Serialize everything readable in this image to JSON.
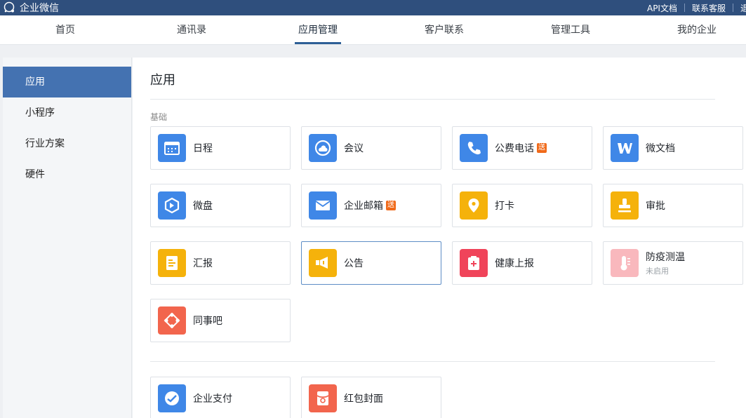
{
  "app": {
    "title": "企业微信"
  },
  "toplinks": [
    "API文档",
    "联系客服",
    "退"
  ],
  "nav": [
    "首页",
    "通讯录",
    "应用管理",
    "客户联系",
    "管理工具",
    "我的企业"
  ],
  "nav_active": "应用管理",
  "sidebar": [
    "应用",
    "小程序",
    "行业方案",
    "硬件"
  ],
  "sidebar_active": "应用",
  "main": {
    "title": "应用",
    "section_label": "基础"
  },
  "apps": [
    {
      "name": "日程",
      "icon": "calendar-icon",
      "color": "#3f87e7"
    },
    {
      "name": "会议",
      "icon": "meeting-icon",
      "color": "#3f87e7"
    },
    {
      "name": "公费电话",
      "badge": "送",
      "icon": "phone-icon",
      "color": "#3f87e7"
    },
    {
      "name": "微文档",
      "icon": "doc-icon",
      "color": "#3f87e7"
    },
    {
      "name": "微盘",
      "icon": "drive-icon",
      "color": "#3f87e7"
    },
    {
      "name": "企业邮箱",
      "badge": "送",
      "icon": "mail-icon",
      "color": "#3f87e7"
    },
    {
      "name": "打卡",
      "icon": "location-icon",
      "color": "#f5b20b"
    },
    {
      "name": "审批",
      "icon": "stamp-icon",
      "color": "#f5b20b"
    },
    {
      "name": "汇报",
      "icon": "report-icon",
      "color": "#f5b20b"
    },
    {
      "name": "公告",
      "icon": "megaphone-icon",
      "color": "#f5b20b"
    },
    {
      "name": "健康上报",
      "icon": "health-icon",
      "color": "#f0445a"
    },
    {
      "name": "防疫测温",
      "sub": "未启用",
      "icon": "thermometer-icon",
      "color": "#f9b8bd"
    },
    {
      "name": "同事吧",
      "icon": "community-icon",
      "color": "#f2654d"
    },
    {
      "name": "企业支付",
      "icon": "pay-icon",
      "color": "#3f87e7"
    },
    {
      "name": "红包封面",
      "icon": "redpacket-icon",
      "color": "#f2654d"
    }
  ]
}
